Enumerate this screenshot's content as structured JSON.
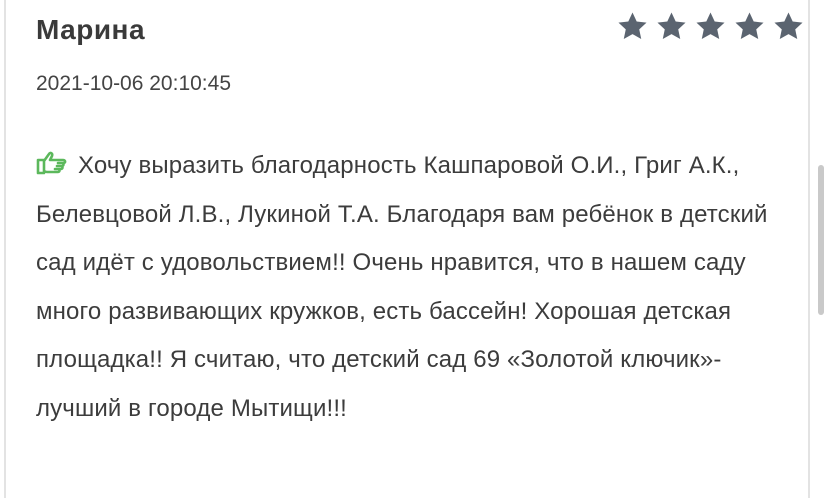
{
  "review": {
    "author": "Марина",
    "date": "2021-10-06 20:10:45",
    "rating": 5,
    "rating_max": 5,
    "rating_icon": "star-icon",
    "text": "Хочу выразить благодарность Кашпаровой О.И., Григ А.К., Белевцовой Л.В., Лукиной Т.А. Благодаря вам ребёнок в детский сад идёт с удовольствием!! Очень нравится, что в нашем саду много развивающих кружков, есть бассейн! Хорошая детская площадка!! Я считаю, что детский сад 69 «Золотой ключик»-лучший в городе Мытищи!!!",
    "text_icon": "thumbs-up-icon"
  },
  "colors": {
    "star": "#5b6470",
    "thumb": "#5cb85c",
    "text": "#3c3c3c",
    "border": "#e3e3e3"
  }
}
